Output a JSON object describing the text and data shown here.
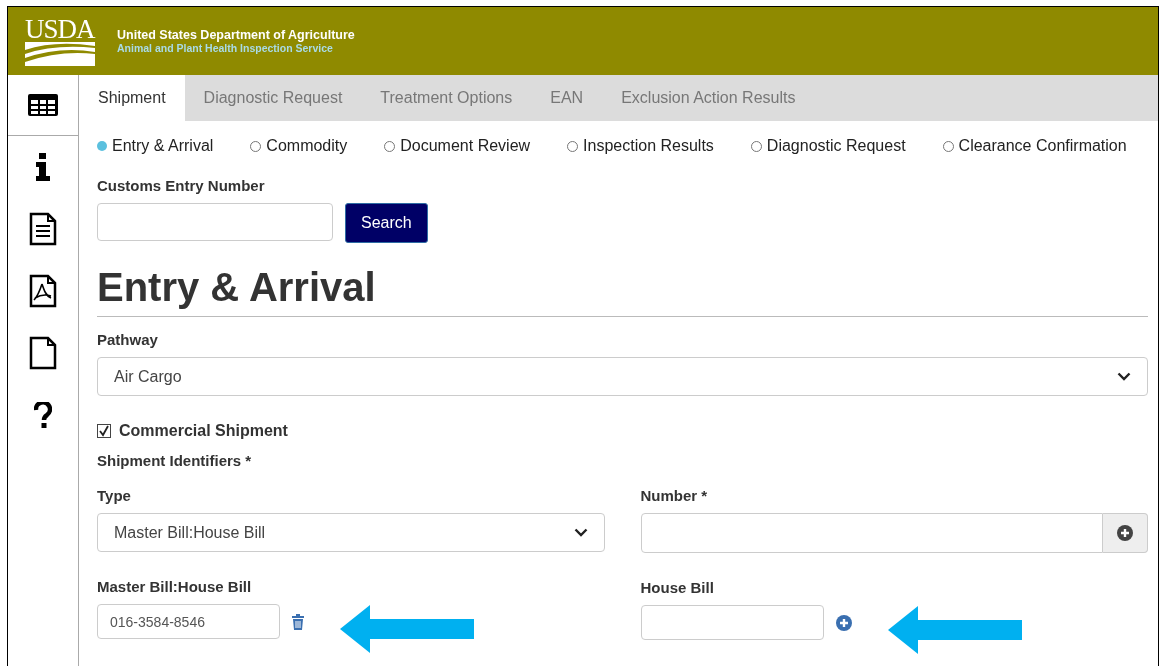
{
  "header": {
    "logo": "USDA",
    "title": "United States Department of Agriculture",
    "subtitle": "Animal and Plant Health Inspection Service"
  },
  "sidebar": {
    "items": [
      {
        "kind": "grid",
        "selected": true
      },
      {
        "kind": "info",
        "selected": false
      },
      {
        "kind": "document",
        "selected": false
      },
      {
        "kind": "pdf",
        "selected": false
      },
      {
        "kind": "blank",
        "selected": false
      },
      {
        "kind": "help",
        "selected": false
      }
    ]
  },
  "tabs": [
    {
      "label": "Shipment",
      "selected": true
    },
    {
      "label": "Diagnostic Request",
      "selected": false
    },
    {
      "label": "Treatment Options",
      "selected": false
    },
    {
      "label": "EAN",
      "selected": false
    },
    {
      "label": "Exclusion Action Results",
      "selected": false
    }
  ],
  "steps": [
    {
      "label": "Entry & Arrival",
      "selected": true
    },
    {
      "label": "Commodity",
      "selected": false
    },
    {
      "label": "Document Review",
      "selected": false
    },
    {
      "label": "Inspection Results",
      "selected": false
    },
    {
      "label": "Diagnostic Request",
      "selected": false
    },
    {
      "label": "Clearance Confirmation",
      "selected": false
    }
  ],
  "customs_entry": {
    "label": "Customs Entry Number",
    "button": "Search"
  },
  "heading": "Entry & Arrival",
  "pathway": {
    "label": "Pathway",
    "value": "Air Cargo"
  },
  "commercial_shipment": {
    "label": "Commercial Shipment",
    "checked": true
  },
  "shipment_identifiers": {
    "label": "Shipment Identifiers *",
    "type_label": "Type",
    "type_value": "Master Bill:House Bill",
    "number_label": "Number *"
  },
  "master_bill": {
    "label": "Master Bill:House Bill",
    "value": "016-3584-8546"
  },
  "house_bill": {
    "label": "House Bill"
  }
}
